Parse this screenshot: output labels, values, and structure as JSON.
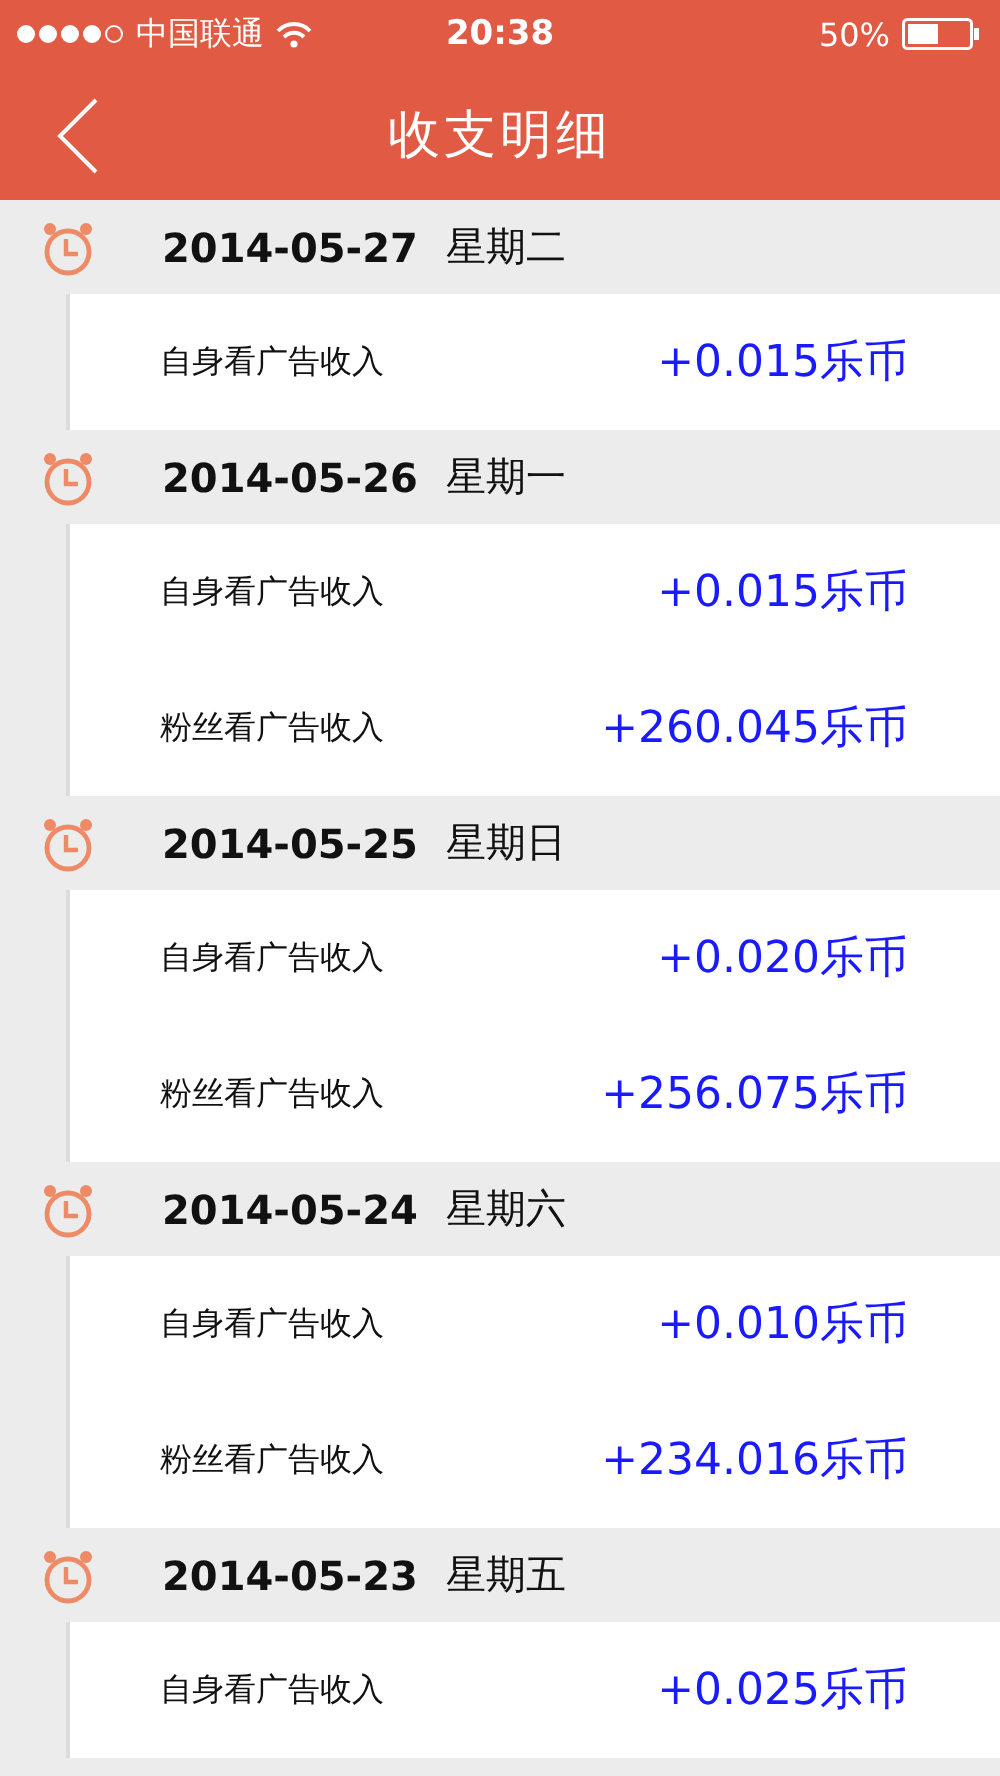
{
  "status_bar": {
    "carrier": "中国联通",
    "time": "20:38",
    "battery": "50%"
  },
  "nav": {
    "title": "收支明细"
  },
  "days": [
    {
      "date": "2014-05-27",
      "weekday": "星期二",
      "entries": [
        {
          "label": "自身看广告收入",
          "amount": "+0.015乐币"
        }
      ]
    },
    {
      "date": "2014-05-26",
      "weekday": "星期一",
      "entries": [
        {
          "label": "自身看广告收入",
          "amount": "+0.015乐币"
        },
        {
          "label": "粉丝看广告收入",
          "amount": "+260.045乐币"
        }
      ]
    },
    {
      "date": "2014-05-25",
      "weekday": "星期日",
      "entries": [
        {
          "label": "自身看广告收入",
          "amount": "+0.020乐币"
        },
        {
          "label": "粉丝看广告收入",
          "amount": "+256.075乐币"
        }
      ]
    },
    {
      "date": "2014-05-24",
      "weekday": "星期六",
      "entries": [
        {
          "label": "自身看广告收入",
          "amount": "+0.010乐币"
        },
        {
          "label": "粉丝看广告收入",
          "amount": "+234.016乐币"
        }
      ]
    },
    {
      "date": "2014-05-23",
      "weekday": "星期五",
      "entries": [
        {
          "label": "自身看广告收入",
          "amount": "+0.025乐币"
        }
      ]
    }
  ]
}
